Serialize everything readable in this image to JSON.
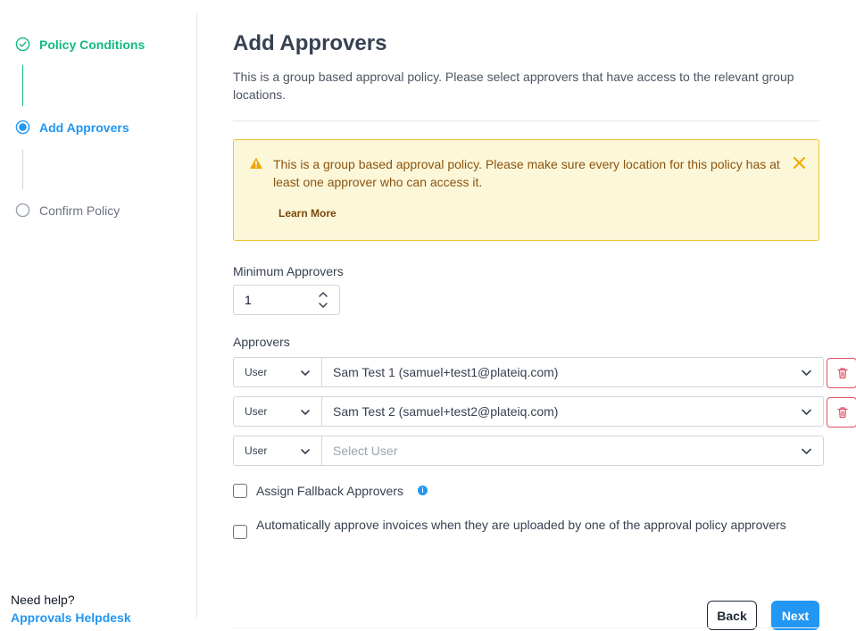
{
  "stepper": {
    "steps": [
      {
        "label": "Policy Conditions",
        "state": "complete"
      },
      {
        "label": "Add Approvers",
        "state": "active"
      },
      {
        "label": "Confirm Policy",
        "state": "pending"
      }
    ]
  },
  "help": {
    "question": "Need help?",
    "link": "Approvals Helpdesk"
  },
  "main": {
    "title": "Add Approvers",
    "description": "This is a group based approval policy. Please select approvers that have access to the relevant group locations."
  },
  "alert": {
    "message": "This is a group based approval policy. Please make sure every location for this policy has at least one approver who can access it.",
    "link": "Learn More"
  },
  "min_approvers": {
    "label": "Minimum Approvers",
    "value": "1"
  },
  "approvers": {
    "label": "Approvers",
    "rows": [
      {
        "type": "User",
        "user": "Sam Test 1 (samuel+test1@plateiq.com)"
      },
      {
        "type": "User",
        "user": "Sam Test 2 (samuel+test2@plateiq.com)"
      },
      {
        "type": "User",
        "placeholder": "Select User"
      }
    ]
  },
  "options": {
    "fallback": "Assign Fallback Approvers",
    "auto_approve": "Automatically approve invoices when they are uploaded by one of the approval policy approvers"
  },
  "buttons": {
    "back": "Back",
    "next": "Next"
  },
  "colors": {
    "complete": "#10b981",
    "active": "#2196f3",
    "warning_bg": "#fdf7d9",
    "warning_border": "#f0c22e",
    "danger": "#e05263"
  }
}
